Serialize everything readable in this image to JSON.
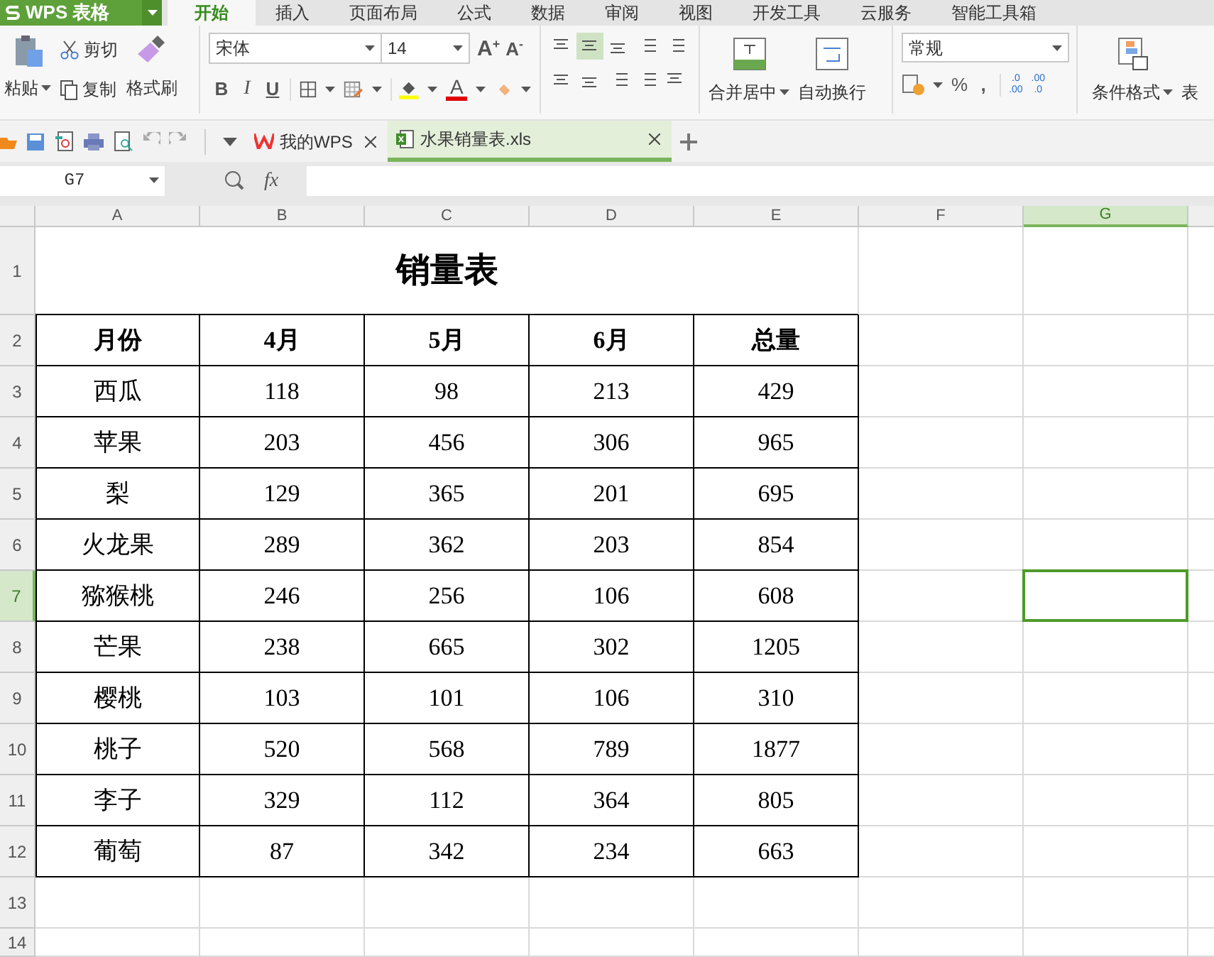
{
  "app": {
    "logo": "WPS 表格"
  },
  "menu_tabs": [
    {
      "label": "开始",
      "selected": true
    },
    {
      "label": "插入",
      "selected": false
    },
    {
      "label": "页面布局",
      "selected": false
    },
    {
      "label": "公式",
      "selected": false
    },
    {
      "label": "数据",
      "selected": false
    },
    {
      "label": "审阅",
      "selected": false
    },
    {
      "label": "视图",
      "selected": false
    },
    {
      "label": "开发工具",
      "selected": false
    },
    {
      "label": "云服务",
      "selected": false
    },
    {
      "label": "智能工具箱",
      "selected": false
    }
  ],
  "ribbon": {
    "paste": "粘贴",
    "cut": "剪切",
    "copy": "复制",
    "format_painter": "格式刷",
    "font_name": "宋体",
    "font_size": "14",
    "grow": "A",
    "grow_sign": "+",
    "shrink": "A",
    "shrink_sign": "-",
    "bold": "B",
    "italic": "I",
    "underline": "U",
    "font_color": "A",
    "align_top": [
      {
        "selected": false
      },
      {
        "selected": true
      },
      {
        "selected": false
      },
      {
        "selected": false
      },
      {
        "selected": false
      }
    ],
    "align_bottom": [
      {
        "selected": false
      },
      {
        "selected": false
      },
      {
        "selected": false
      },
      {
        "selected": false
      },
      {
        "selected": false
      }
    ],
    "merge": "合并居中",
    "wrap": "自动换行",
    "number_format": "常规",
    "percent": "%",
    "comma": ",",
    "inc_decimal": [
      ".0",
      ".00"
    ],
    "dec_decimal": [
      ".00",
      ".0"
    ],
    "conditional": "条件格式",
    "table_style": "表"
  },
  "doc_tabs": [
    {
      "label": "我的WPS",
      "kind": "home",
      "selected": false
    },
    {
      "label": "水果销量表.xls",
      "kind": "sheet",
      "selected": true
    }
  ],
  "formula_bar": {
    "name_box": "G7",
    "fx": "fx"
  },
  "sheet": {
    "columns": [
      {
        "label": "A",
        "selected": false
      },
      {
        "label": "B",
        "selected": false
      },
      {
        "label": "C",
        "selected": false
      },
      {
        "label": "D",
        "selected": false
      },
      {
        "label": "E",
        "selected": false
      },
      {
        "label": "F",
        "selected": false
      },
      {
        "label": "G",
        "selected": true
      }
    ],
    "rows": [
      {
        "header": "1",
        "kind": "title",
        "selected": false,
        "cells": [
          "",
          "",
          "销量表",
          "",
          ""
        ]
      },
      {
        "header": "2",
        "kind": "head",
        "selected": false,
        "cells": [
          "月份",
          "4月",
          "5月",
          "6月",
          "总量"
        ]
      },
      {
        "header": "3",
        "kind": "data",
        "selected": false,
        "cells": [
          "西瓜",
          "118",
          "98",
          "213",
          "429"
        ]
      },
      {
        "header": "4",
        "kind": "data",
        "selected": false,
        "cells": [
          "苹果",
          "203",
          "456",
          "306",
          "965"
        ]
      },
      {
        "header": "5",
        "kind": "data",
        "selected": false,
        "cells": [
          "梨",
          "129",
          "365",
          "201",
          "695"
        ]
      },
      {
        "header": "6",
        "kind": "data",
        "selected": false,
        "cells": [
          "火龙果",
          "289",
          "362",
          "203",
          "854"
        ]
      },
      {
        "header": "7",
        "kind": "data",
        "selected": true,
        "cells": [
          "猕猴桃",
          "246",
          "256",
          "106",
          "608"
        ]
      },
      {
        "header": "8",
        "kind": "data",
        "selected": false,
        "cells": [
          "芒果",
          "238",
          "665",
          "302",
          "1205"
        ]
      },
      {
        "header": "9",
        "kind": "data",
        "selected": false,
        "cells": [
          "樱桃",
          "103",
          "101",
          "106",
          "310"
        ]
      },
      {
        "header": "10",
        "kind": "data",
        "selected": false,
        "cells": [
          "桃子",
          "520",
          "568",
          "789",
          "1877"
        ]
      },
      {
        "header": "11",
        "kind": "data",
        "selected": false,
        "cells": [
          "李子",
          "329",
          "112",
          "364",
          "805"
        ]
      },
      {
        "header": "12",
        "kind": "data",
        "selected": false,
        "cells": [
          "葡萄",
          "87",
          "342",
          "234",
          "663"
        ]
      },
      {
        "header": "13",
        "kind": "empty",
        "selected": false,
        "cells": []
      },
      {
        "header": "14",
        "kind": "empty",
        "selected": false,
        "cells": []
      }
    ]
  }
}
